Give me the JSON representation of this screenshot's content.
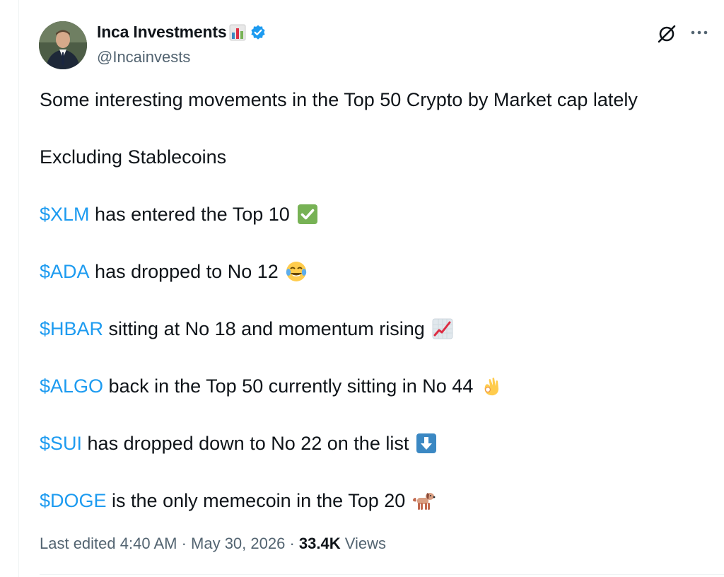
{
  "author": {
    "display_name": "Inca Investments",
    "handle": "@Incainvests",
    "badge_icon": "bar-chart-emoji",
    "verified_icon": "verified-badge-icon",
    "verified_color": "#1d9bf0"
  },
  "header_actions": {
    "grok_icon": "grok-icon",
    "more_icon": "more-icon"
  },
  "tweet": {
    "line1": "Some interesting movements in the Top 50 Crypto by Market cap lately",
    "line2": "Excluding Stablecoins",
    "items": [
      {
        "cashtag": "$XLM",
        "text": " has entered the Top 10",
        "emoji": "check-mark-emoji"
      },
      {
        "cashtag": "$ADA",
        "text": " has dropped to No 12",
        "emoji": "tears-of-joy-emoji"
      },
      {
        "cashtag": "$HBAR",
        "text": " sitting at No 18 and momentum rising",
        "emoji": "chart-increasing-emoji"
      },
      {
        "cashtag": "$ALGO",
        "text": " back in the Top 50 currently sitting in No 44",
        "emoji": "ok-hand-emoji"
      },
      {
        "cashtag": "$SUI",
        "text": " has dropped down to No 22 on the list",
        "emoji": "down-arrow-emoji"
      },
      {
        "cashtag": "$DOGE",
        "text": " is the only memecoin in the Top 20",
        "emoji": "dog-emoji"
      }
    ]
  },
  "meta": {
    "edited": "Last edited 4:40 AM · May 30, 2026 · ",
    "views_count": "33.4K",
    "views_label": " Views"
  },
  "colors": {
    "link": "#1d9bf0",
    "secondary_text": "#536471",
    "primary_text": "#0f1419"
  }
}
